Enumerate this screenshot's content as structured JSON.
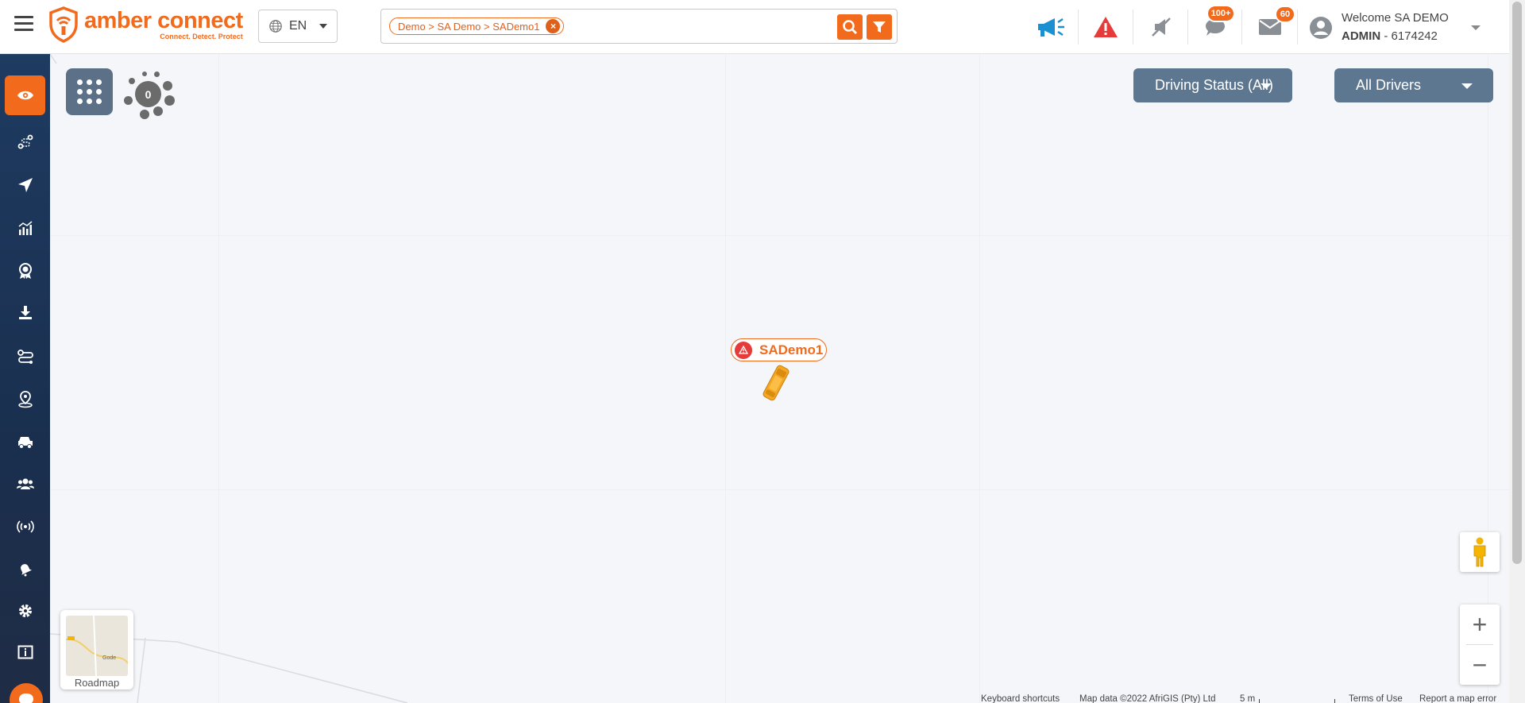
{
  "header": {
    "logo": {
      "name": "amber connect",
      "tagline": "Connect. Detect. Protect"
    },
    "language": {
      "selected": "EN"
    },
    "search": {
      "breadcrumb_chip": "Demo > SA Demo > SADemo1"
    },
    "notifications": {
      "messages_count": "100+",
      "mail_count": "60"
    },
    "user": {
      "welcome": "Welcome SA DEMO",
      "role": "ADMIN",
      "account_id": " - 6174242"
    }
  },
  "sidebar": {
    "items": [
      {
        "icon": "eye-icon",
        "active": true
      },
      {
        "icon": "route-icon"
      },
      {
        "icon": "navigation-icon"
      },
      {
        "icon": "analytics-icon"
      },
      {
        "icon": "award-icon"
      },
      {
        "icon": "download-icon"
      },
      {
        "icon": "trips-icon"
      },
      {
        "icon": "geofence-icon"
      },
      {
        "icon": "vehicle-icon"
      },
      {
        "icon": "users-icon"
      },
      {
        "icon": "broadcast-icon"
      },
      {
        "icon": "alerts-icon"
      },
      {
        "icon": "settings-icon"
      },
      {
        "icon": "info-icon"
      }
    ]
  },
  "map": {
    "cluster_count": "0",
    "filters": {
      "driving_status": "Driving Status (All)",
      "drivers": "All Drivers"
    },
    "vehicle": {
      "name": "SADemo1",
      "status": "alert"
    },
    "map_type": {
      "label": "Roadmap",
      "thumb_label": "Gode"
    },
    "attribution": {
      "shortcuts": "Keyboard shortcuts",
      "map_data": "Map data ©2022 AfriGIS (Pty) Ltd",
      "scale": "5 m",
      "terms": "Terms of Use",
      "report": "Report a map error"
    }
  },
  "colors": {
    "brand": "#f26b1d",
    "sidebar": "#1e3b61",
    "control": "#5d7790",
    "alert": "#e53b3b",
    "info": "#1a8fd1"
  }
}
